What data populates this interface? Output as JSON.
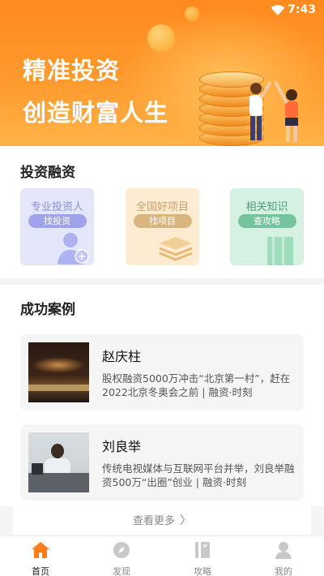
{
  "status_bar": {
    "time": "7:43"
  },
  "banner": {
    "line1": "精准投资",
    "line2": "创造财富人生"
  },
  "section_invest": {
    "title": "投资融资",
    "cards": [
      {
        "title": "专业投资人",
        "action": "找投资",
        "bg": "#e4e6fb",
        "title_color": "#8a8fd6",
        "pill_color": "#9fa4ea"
      },
      {
        "title": "全国好项目",
        "action": "找项目",
        "bg": "#fdecd2",
        "title_color": "#c9a06a",
        "pill_color": "#d9b57e"
      },
      {
        "title": "相关知识",
        "action": "查攻略",
        "bg": "#d4f1e2",
        "title_color": "#4c9c78",
        "pill_color": "#74c49e"
      }
    ]
  },
  "section_cases": {
    "title": "成功案例",
    "items": [
      {
        "name": "赵庆柱",
        "desc": "股权融资5000万冲击“北京第一村”，赶在2022北京冬奥会之前 | 融资·时刻"
      },
      {
        "name": "刘良举",
        "desc": "传统电视媒体与互联网平台并举，刘良举融资500万“出圈”创业 | 融资·时刻"
      }
    ],
    "more_label": "查看更多"
  },
  "tabbar": {
    "active_color": "#ff7d1a",
    "tabs": [
      {
        "label": "首页",
        "icon": "home-icon",
        "active": true
      },
      {
        "label": "发现",
        "icon": "compass-icon",
        "active": false
      },
      {
        "label": "攻略",
        "icon": "bookmark-icon",
        "active": false
      },
      {
        "label": "我的",
        "icon": "user-icon",
        "active": false
      }
    ]
  }
}
